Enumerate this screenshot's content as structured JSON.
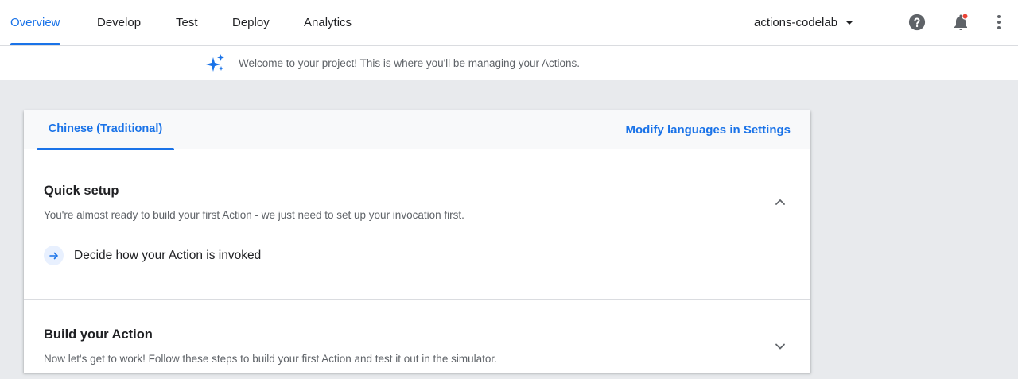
{
  "nav": {
    "tabs": [
      {
        "label": "Overview",
        "active": true
      },
      {
        "label": "Develop",
        "active": false
      },
      {
        "label": "Test",
        "active": false
      },
      {
        "label": "Deploy",
        "active": false
      },
      {
        "label": "Analytics",
        "active": false
      }
    ],
    "project": "actions-codelab",
    "icons": [
      "help-icon",
      "notifications-icon",
      "more-vert-icon"
    ],
    "notification_dot": true
  },
  "banner": {
    "icon": "sparkle-icon",
    "text": "Welcome to your project! This is where you'll be managing your Actions."
  },
  "card": {
    "language_tab": "Chinese (Traditional)",
    "modify_link": "Modify languages in Settings",
    "quick_setup": {
      "title": "Quick setup",
      "description": "You're almost ready to build your first Action - we just need to set up your invocation first.",
      "expanded": true,
      "step": "Decide how your Action is invoked"
    },
    "build": {
      "title": "Build your Action",
      "description": "Now let's get to work! Follow these steps to build your first Action and test it out in the simulator.",
      "expanded": false
    }
  },
  "colors": {
    "accent": "#1a73e8",
    "background": "#e8eaed",
    "notification_dot": "#ea4335",
    "sparkle": "#1a73e8"
  }
}
